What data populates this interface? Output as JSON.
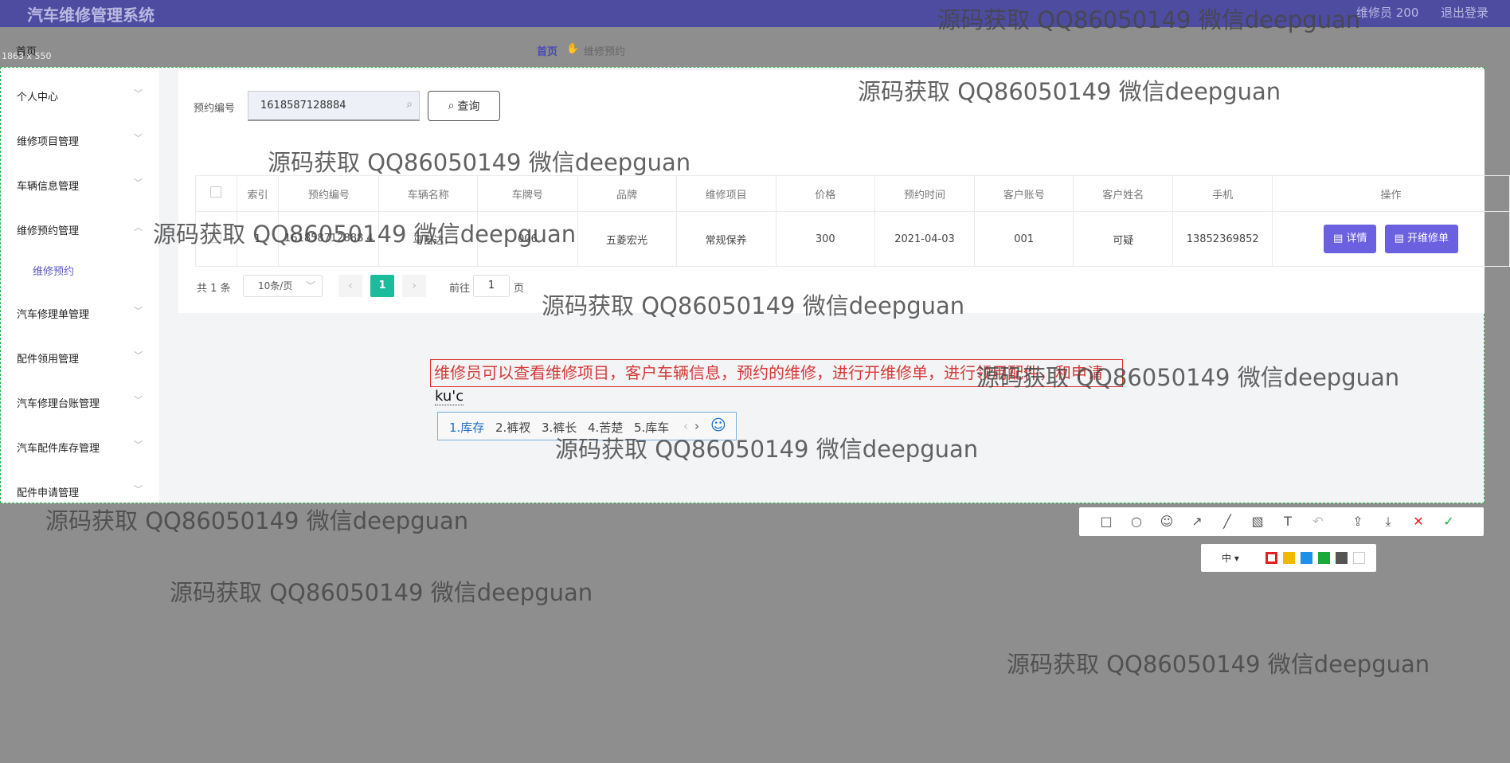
{
  "header": {
    "app_title": "汽车维修管理系统",
    "user_label": "维修员 200",
    "logout_label": "退出登录"
  },
  "nav": {
    "home": "首页",
    "breadcrumb_home": "首页",
    "breadcrumb_current": "维修预约"
  },
  "capture": {
    "size_label": "1863 x 550"
  },
  "sidebar": {
    "items": [
      {
        "label": "个人中心"
      },
      {
        "label": "维修项目管理"
      },
      {
        "label": "车辆信息管理"
      },
      {
        "label": "维修预约管理"
      },
      {
        "label": "汽车修理单管理"
      },
      {
        "label": "配件领用管理"
      },
      {
        "label": "汽车修理台账管理"
      },
      {
        "label": "汽车配件库存管理"
      },
      {
        "label": "配件申请管理"
      }
    ],
    "sub_item": "维修预约"
  },
  "search": {
    "label": "预约编号",
    "value": "1618587128884",
    "button": "查询"
  },
  "table": {
    "headers": [
      "索引",
      "预约编号",
      "车辆名称",
      "车牌号",
      "品牌",
      "维修项目",
      "价格",
      "预约时间",
      "客户账号",
      "客户姓名",
      "手机",
      "操作"
    ],
    "rows": [
      {
        "index": "1",
        "booking_no": "161858712888 4",
        "vehicle": "马自达",
        "plate": "006",
        "brand": "五菱宏光",
        "project": "常规保养",
        "price": "300",
        "time": "2021-04-03",
        "account": "001",
        "name": "可疑",
        "phone": "13852369852",
        "detail_label": "详情",
        "open_label": "开维修单"
      }
    ]
  },
  "pager": {
    "total": "共 1 条",
    "size": "10条/页",
    "current": "1",
    "goto": "前往",
    "goto_value": "1",
    "page": "页"
  },
  "annotation": "维修员可以查看维修项目，客户车辆信息，预约的维修，进行开维修单，进行领用配件，和申请",
  "ime": {
    "composing": "ku'c",
    "candidates": [
      "1.库存",
      "2.裤衩",
      "3.裤长",
      "4.苦楚",
      "5.库车"
    ]
  },
  "capture_toolbar": {
    "tools": [
      "rectangle-icon",
      "circle-icon",
      "mosaic-icon",
      "arrow-icon",
      "pen-icon",
      "blur-icon",
      "text-icon",
      "undo-icon",
      "share-icon",
      "download-icon",
      "close-icon",
      "confirm-icon"
    ],
    "size_option": "中",
    "colors": [
      "#e02020",
      "#f5b800",
      "#1e90e8",
      "#1aaa3a",
      "#555555",
      "#ffffff"
    ]
  },
  "watermark": "源码获取 QQ86050149 微信deepguan"
}
